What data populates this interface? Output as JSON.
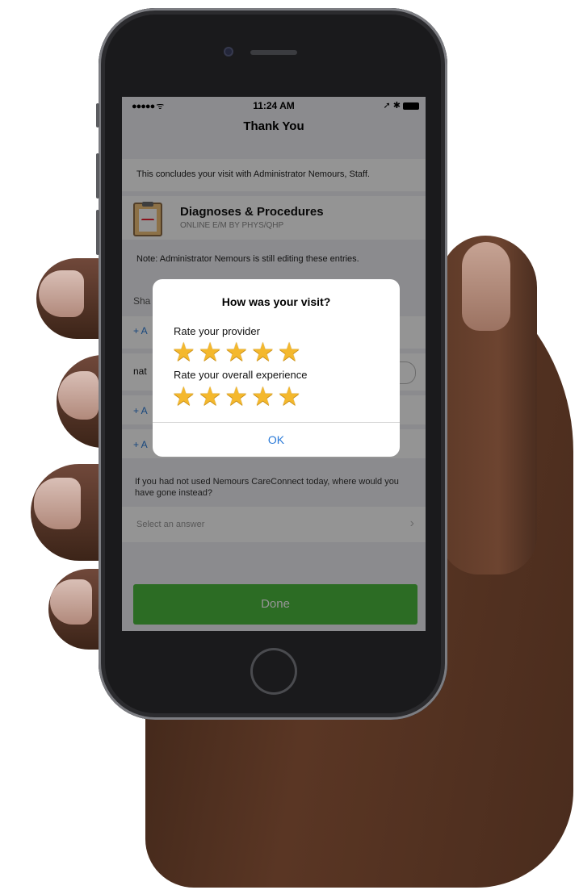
{
  "status_bar": {
    "signal": "●●●●● ᯤ",
    "time": "11:24 AM",
    "right_icons": "➚ ✱"
  },
  "nav": {
    "title": "Thank You"
  },
  "conclusion": {
    "text": "This concludes your visit with Administrator Nemours, Staff."
  },
  "diagnoses": {
    "title": "Diagnoses & Procedures",
    "subtitle": "ONLINE E/M BY PHYS/QHP",
    "icon": "clipboard-icon"
  },
  "note": {
    "text": "Note: Administrator Nemours is still editing these entries."
  },
  "background_rows": {
    "share_stub": "Sha",
    "add_stub_1": "+ A",
    "nat_stub": "nat",
    "add_stub_2": "+ A",
    "add_stub_3": "+ A"
  },
  "question": {
    "text": "If you had not used Nemours CareConnect today, where would you have gone instead?"
  },
  "answer": {
    "placeholder": "Select an answer",
    "chevron": "›"
  },
  "done_button": {
    "label": "Done"
  },
  "rating_dialog": {
    "title": "How was your visit?",
    "provider_label": "Rate your provider",
    "provider_stars": [
      "★",
      "★",
      "★",
      "★",
      "★"
    ],
    "provider_rating": 5,
    "experience_label": "Rate your overall experience",
    "experience_stars": [
      "★",
      "★",
      "★",
      "★",
      "★"
    ],
    "experience_rating": 5,
    "ok_label": "OK"
  },
  "colors": {
    "accent_blue": "#2a7ad8",
    "done_green": "#4cba3e",
    "star_gold": "#f4b82d"
  }
}
